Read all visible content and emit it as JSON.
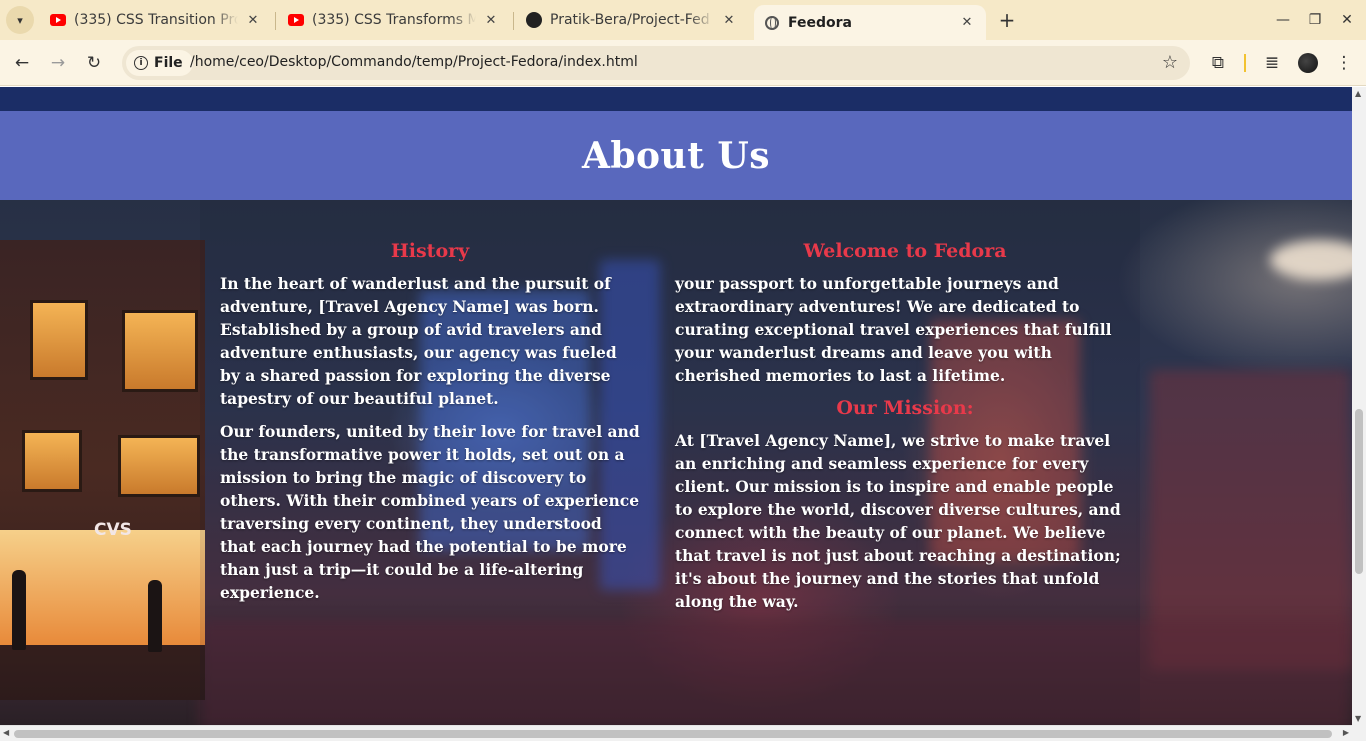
{
  "browser": {
    "tabs": [
      {
        "title": "(335) CSS Transition Pro",
        "favicon": "youtube-icon",
        "active": false
      },
      {
        "title": "(335) CSS Transforms M",
        "favicon": "youtube-icon",
        "active": false
      },
      {
        "title": "Pratik-Bera/Project-Fed",
        "favicon": "github-icon",
        "active": false
      },
      {
        "title": "Feedora",
        "favicon": "globe-icon",
        "active": true
      }
    ],
    "omnibox": {
      "scheme_chip": "File",
      "url": "/home/ceo/Desktop/Commando/temp/Project-Fedora/index.html"
    }
  },
  "page": {
    "about_title": "About Us",
    "history": {
      "heading": "History",
      "paragraphs": [
        "In the heart of wanderlust and the pursuit of adventure, [Travel Agency Name] was born. Established by a group of avid travelers and adventure enthusiasts, our agency was fueled by a shared passion for exploring the diverse tapestry of our beautiful planet.",
        "Our founders, united by their love for travel and the transformative power it holds, set out on a mission to bring the magic of discovery to others. With their combined years of experience traversing every continent, they understood that each journey had the potential to be more than just a trip—it could be a life-altering experience."
      ]
    },
    "welcome": {
      "heading": "Welcome to Fedora",
      "text": "your passport to unforgettable journeys and extraordinary adventures! We are dedicated to curating exceptional travel experiences that fulfill your wanderlust dreams and leave you with cherished memories to last a lifetime."
    },
    "mission": {
      "heading": "Our Mission:",
      "text": "At [Travel Agency Name], we strive to make travel an enriching and seamless experience for every client. Our mission is to inspire and enable people to explore the world, discover diverse cultures, and connect with the beauty of our planet. We believe that travel is not just about reaching a destination; it's about the journey and the stories that unfold along the way."
    },
    "store_sign": "CVS"
  },
  "colors": {
    "nav_bar": "#1b2d66",
    "about_header": "#5968bd",
    "section_heading": "#e8394a",
    "tabstrip": "#f6e9c8"
  }
}
